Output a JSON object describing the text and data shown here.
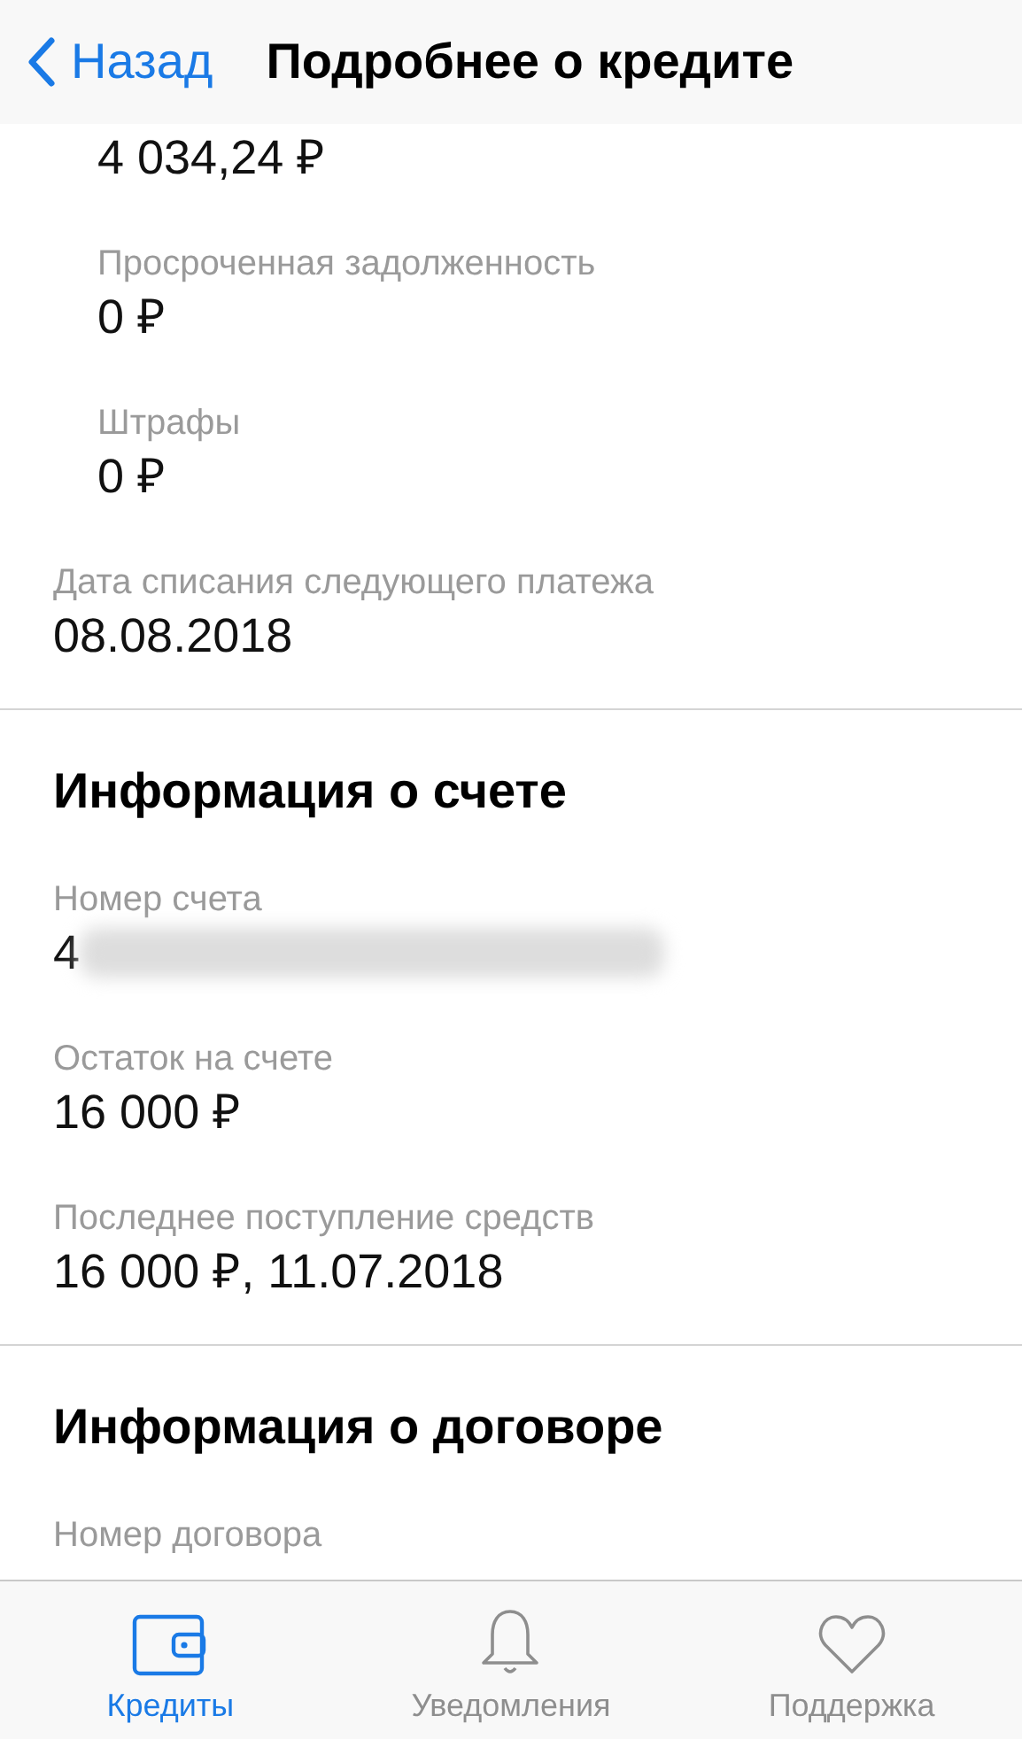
{
  "nav": {
    "back": "Назад",
    "title": "Подробнее о кредите"
  },
  "sections": [
    {
      "items": [
        {
          "kind": "sub",
          "value": "4 034,24 ₽"
        },
        {
          "kind": "sub",
          "label": "Просроченная задолженность",
          "value": "0 ₽"
        },
        {
          "kind": "sub",
          "label": "Штрафы",
          "value": "0 ₽"
        },
        {
          "kind": "main",
          "label": "Дата списания следующего платежа",
          "value": "08.08.2018"
        }
      ]
    },
    {
      "heading": "Информация о счете",
      "items": [
        {
          "kind": "redacted",
          "label": "Номер счета",
          "value": "4"
        },
        {
          "kind": "main",
          "label": "Остаток на счете",
          "value": "16 000 ₽"
        },
        {
          "kind": "main",
          "label": "Последнее поступление средств",
          "value": "16 000 ₽, 11.07.2018"
        }
      ]
    },
    {
      "heading": "Информация о договоре",
      "items": [
        {
          "kind": "main",
          "label": "Номер договора"
        }
      ]
    }
  ],
  "tabs": [
    {
      "kind": "wallet",
      "label": "Кредиты",
      "selected": true
    },
    {
      "kind": "bell",
      "label": "Уведомления",
      "selected": false
    },
    {
      "kind": "heart",
      "label": "Поддержка",
      "selected": false
    }
  ]
}
